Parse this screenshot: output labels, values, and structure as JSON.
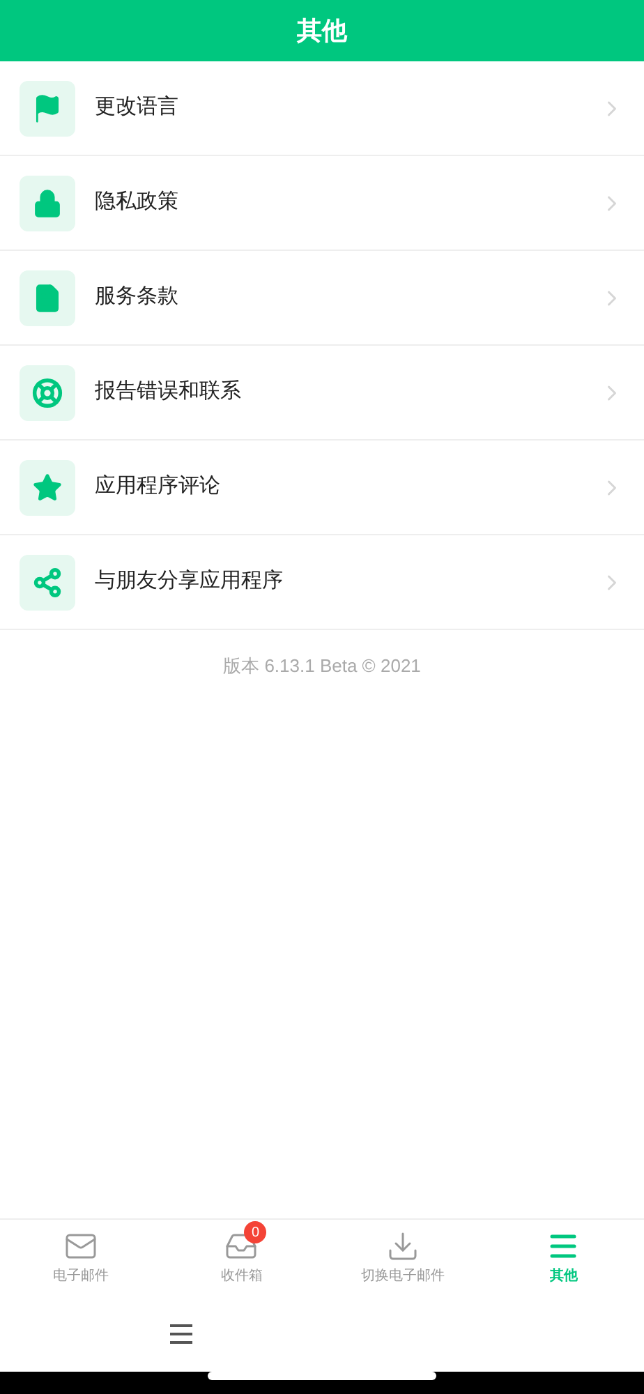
{
  "header": {
    "title": "其他"
  },
  "menu": [
    {
      "kind": "flag",
      "label": "更改语言"
    },
    {
      "kind": "lock",
      "label": "隐私政策"
    },
    {
      "kind": "document",
      "label": "服务条款"
    },
    {
      "kind": "lifebuoy",
      "label": "报告错误和联系"
    },
    {
      "kind": "star",
      "label": "应用程序评论"
    },
    {
      "kind": "share",
      "label": "与朋友分享应用程序"
    }
  ],
  "version": "版本 6.13.1 Beta © 2021",
  "tabs": [
    {
      "kind": "mail",
      "label": "电子邮件",
      "selected": false
    },
    {
      "kind": "inbox",
      "label": "收件箱",
      "selected": false,
      "badge": "0"
    },
    {
      "kind": "download",
      "label": "切换电子邮件",
      "selected": false
    },
    {
      "kind": "menu",
      "label": "其他",
      "selected": true
    }
  ]
}
